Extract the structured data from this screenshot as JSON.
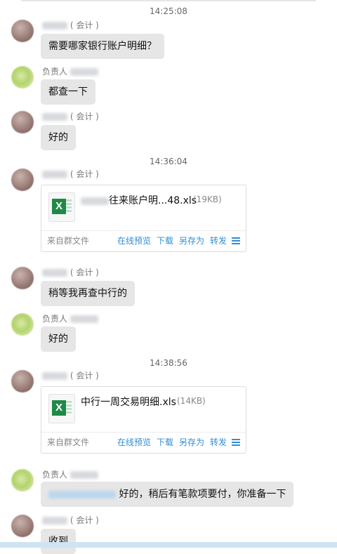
{
  "times": [
    "14:25:08",
    "14:36:04",
    "14:38:56"
  ],
  "names": {
    "accountant_tag": "( 会计 )",
    "manager": "负责人"
  },
  "messages": {
    "m1": "需要哪家银行账户明细？",
    "m2": "都查一下",
    "m3": "好的",
    "m5": "稍等我再查中行的",
    "m6": "好的",
    "m8": "好的，稍后有笔款项要付，你准备一下",
    "m9": "收到"
  },
  "files": [
    {
      "name": "往来账户明...48.xls",
      "size": "(19KB)",
      "icon": "excel-icon"
    },
    {
      "name": "中行一周交易明细.xls",
      "size": "(14KB)",
      "icon": "excel-icon"
    }
  ],
  "file_actions": {
    "source": "来自群文件",
    "preview": "在线预览",
    "download": "下载",
    "save_as": "另存为",
    "forward": "转发",
    "menu_icon": "hamburger-menu-icon"
  },
  "colors": {
    "bubble": "#e6e6e6",
    "link": "#2f8ed3",
    "excel": "#1f8a45"
  }
}
